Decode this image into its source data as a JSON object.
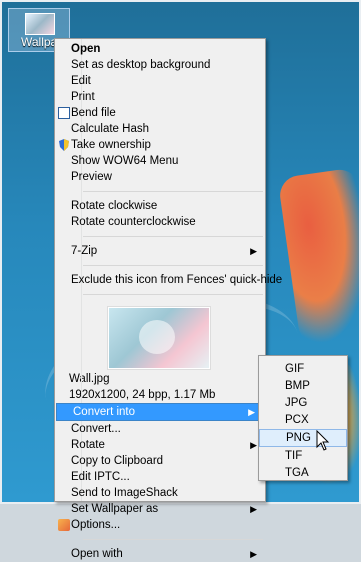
{
  "desktop_icon": {
    "label": "Wallpa"
  },
  "menu_items": [
    {
      "label": "Open",
      "bold": true,
      "icon": ""
    },
    {
      "label": "Set as desktop background",
      "icon": ""
    },
    {
      "label": "Edit",
      "icon": ""
    },
    {
      "label": "Print",
      "icon": ""
    },
    {
      "label": "Bend file",
      "icon": "bend-file-icon"
    },
    {
      "label": "Calculate Hash",
      "icon": ""
    },
    {
      "label": "Take ownership",
      "icon": "shield-icon"
    },
    {
      "label": "Show WOW64 Menu",
      "icon": ""
    },
    {
      "label": "Preview",
      "icon": ""
    },
    {
      "label": "Rotate clockwise",
      "icon": ""
    },
    {
      "label": "Rotate counterclockwise",
      "icon": ""
    },
    {
      "label": "7-Zip",
      "icon": ""
    },
    {
      "label": "Exclude this icon from Fences' quick-hide",
      "icon": ""
    }
  ],
  "preview": {
    "filename": "Wall.jpg",
    "details": "1920x1200, 24 bpp, 1.17 Mb"
  },
  "menu_items_lower": [
    {
      "label": "Convert into",
      "highlighted": true
    },
    {
      "label": "Convert..."
    },
    {
      "label": "Rotate"
    },
    {
      "label": "Copy to Clipboard"
    },
    {
      "label": "Edit IPTC..."
    },
    {
      "label": "Send to ImageShack"
    },
    {
      "label": "Set Wallpaper as"
    },
    {
      "label": "Options...",
      "icon": "options-icon"
    },
    {
      "label": "Open with"
    }
  ],
  "submenu": [
    "GIF",
    "BMP",
    "JPG",
    "PCX",
    "PNG",
    "TIF",
    "TGA"
  ],
  "submenu_hover": "PNG",
  "colors": {
    "highlight": "#3399ff",
    "menu_bg": "#f0f0f0"
  }
}
